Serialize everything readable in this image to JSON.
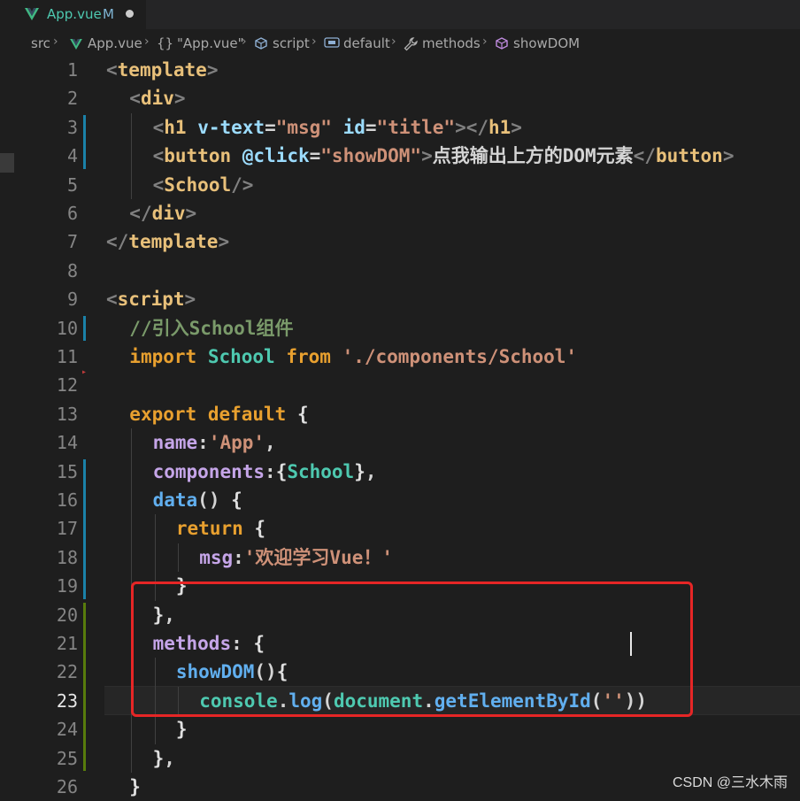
{
  "tab": {
    "title": "App.vue",
    "modified_flag": "M",
    "icon": "vue-icon"
  },
  "breadcrumb": {
    "items": [
      "src",
      "App.vue",
      "\"App.vue\"",
      "script",
      "default",
      "methods",
      "showDOM"
    ],
    "braces_glyph": "{}"
  },
  "editor": {
    "current_line": 23,
    "lines": [
      {
        "n": "1",
        "tokens": [
          [
            "t-punc",
            "<"
          ],
          [
            "t-tag",
            "template"
          ],
          [
            "t-punc",
            ">"
          ]
        ]
      },
      {
        "n": "2",
        "tokens": [
          [
            "t-punc",
            "<"
          ],
          [
            "t-tag",
            "div"
          ],
          [
            "t-punc",
            ">"
          ]
        ]
      },
      {
        "n": "3",
        "tokens": [
          [
            "t-punc",
            "<"
          ],
          [
            "t-tag",
            "h1"
          ],
          [
            "t-text",
            " "
          ],
          [
            "t-attr",
            "v-text"
          ],
          [
            "t-text",
            "="
          ],
          [
            "t-str",
            "\"msg\""
          ],
          [
            "t-text",
            " "
          ],
          [
            "t-attr",
            "id"
          ],
          [
            "t-text",
            "="
          ],
          [
            "t-str",
            "\"title\""
          ],
          [
            "t-punc",
            "></"
          ],
          [
            "t-tag",
            "h1"
          ],
          [
            "t-punc",
            ">"
          ]
        ]
      },
      {
        "n": "4",
        "tokens": [
          [
            "t-punc",
            "<"
          ],
          [
            "t-tag",
            "button"
          ],
          [
            "t-text",
            " "
          ],
          [
            "t-attr",
            "@click"
          ],
          [
            "t-text",
            "="
          ],
          [
            "t-str",
            "\"showDOM\""
          ],
          [
            "t-punc",
            ">"
          ],
          [
            "t-text",
            "点我输出上方的DOM元素"
          ],
          [
            "t-punc",
            "</"
          ],
          [
            "t-tag",
            "button"
          ],
          [
            "t-punc",
            ">"
          ]
        ]
      },
      {
        "n": "5",
        "tokens": [
          [
            "t-punc",
            "<"
          ],
          [
            "t-tag",
            "School"
          ],
          [
            "t-punc",
            "/>"
          ]
        ]
      },
      {
        "n": "6",
        "tokens": [
          [
            "t-punc",
            "</"
          ],
          [
            "t-tag",
            "div"
          ],
          [
            "t-punc",
            ">"
          ]
        ]
      },
      {
        "n": "7",
        "tokens": [
          [
            "t-punc",
            "</"
          ],
          [
            "t-tag",
            "template"
          ],
          [
            "t-punc",
            ">"
          ]
        ]
      },
      {
        "n": "8",
        "tokens": []
      },
      {
        "n": "9",
        "tokens": [
          [
            "t-punc",
            "<"
          ],
          [
            "t-tag",
            "script"
          ],
          [
            "t-punc",
            ">"
          ]
        ]
      },
      {
        "n": "10",
        "tokens": [
          [
            "t-cmt",
            "//引入School组件"
          ]
        ]
      },
      {
        "n": "11",
        "tokens": [
          [
            "t-kw",
            "import"
          ],
          [
            "t-text",
            " "
          ],
          [
            "t-mod",
            "School"
          ],
          [
            "t-text",
            " "
          ],
          [
            "t-kw",
            "from"
          ],
          [
            "t-text",
            " "
          ],
          [
            "t-str",
            "'./components/School'"
          ]
        ]
      },
      {
        "n": "12",
        "tokens": []
      },
      {
        "n": "13",
        "tokens": [
          [
            "t-kw",
            "export"
          ],
          [
            "t-text",
            " "
          ],
          [
            "t-kw",
            "default"
          ],
          [
            "t-text",
            " "
          ],
          [
            "t-brace",
            "{"
          ]
        ]
      },
      {
        "n": "14",
        "tokens": [
          [
            "t-prop",
            "name"
          ],
          [
            "t-text",
            ":"
          ],
          [
            "t-str",
            "'App'"
          ],
          [
            "t-text",
            ","
          ]
        ]
      },
      {
        "n": "15",
        "tokens": [
          [
            "t-prop",
            "components"
          ],
          [
            "t-text",
            ":"
          ],
          [
            "t-brace",
            "{"
          ],
          [
            "t-mod",
            "School"
          ],
          [
            "t-brace",
            "}"
          ],
          [
            "t-text",
            ","
          ]
        ]
      },
      {
        "n": "16",
        "tokens": [
          [
            "t-func",
            "data"
          ],
          [
            "t-br",
            "()"
          ],
          [
            "t-text",
            " "
          ],
          [
            "t-brace",
            "{"
          ]
        ]
      },
      {
        "n": "17",
        "tokens": [
          [
            "t-kw",
            "return"
          ],
          [
            "t-text",
            " "
          ],
          [
            "t-brace",
            "{"
          ]
        ]
      },
      {
        "n": "18",
        "tokens": [
          [
            "t-prop",
            "msg"
          ],
          [
            "t-text",
            ":"
          ],
          [
            "t-str",
            "'欢迎学习Vue！'"
          ]
        ]
      },
      {
        "n": "19",
        "tokens": [
          [
            "t-brace",
            "}"
          ]
        ]
      },
      {
        "n": "20",
        "tokens": [
          [
            "t-brace",
            "}"
          ],
          [
            "t-text",
            ","
          ]
        ]
      },
      {
        "n": "21",
        "tokens": [
          [
            "t-prop",
            "methods"
          ],
          [
            "t-text",
            ":"
          ],
          [
            "t-text",
            " "
          ],
          [
            "t-brace",
            "{"
          ]
        ]
      },
      {
        "n": "22",
        "tokens": [
          [
            "t-func",
            "showDOM"
          ],
          [
            "t-br",
            "()"
          ],
          [
            "t-brace",
            "{"
          ]
        ]
      },
      {
        "n": "23",
        "tokens": [
          [
            "t-mod",
            "console"
          ],
          [
            "t-text",
            "."
          ],
          [
            "t-func",
            "log"
          ],
          [
            "t-br",
            "("
          ],
          [
            "t-mod",
            "document"
          ],
          [
            "t-text",
            "."
          ],
          [
            "t-func",
            "getElementById"
          ],
          [
            "t-br",
            "("
          ],
          [
            "t-str",
            "''"
          ],
          [
            "t-br",
            "))"
          ]
        ]
      },
      {
        "n": "24",
        "tokens": [
          [
            "t-brace",
            "}"
          ]
        ]
      },
      {
        "n": "25",
        "tokens": [
          [
            "t-brace",
            "}"
          ],
          [
            "t-text",
            ","
          ]
        ]
      },
      {
        "n": "26",
        "tokens": [
          [
            "t-brace",
            "}"
          ]
        ]
      }
    ]
  },
  "watermark": "CSDN @三水木雨",
  "colors": {
    "background": "#1e1e1e",
    "highlight_box": "#e62626",
    "tag": "#e8c07a",
    "string": "#ce9178"
  }
}
